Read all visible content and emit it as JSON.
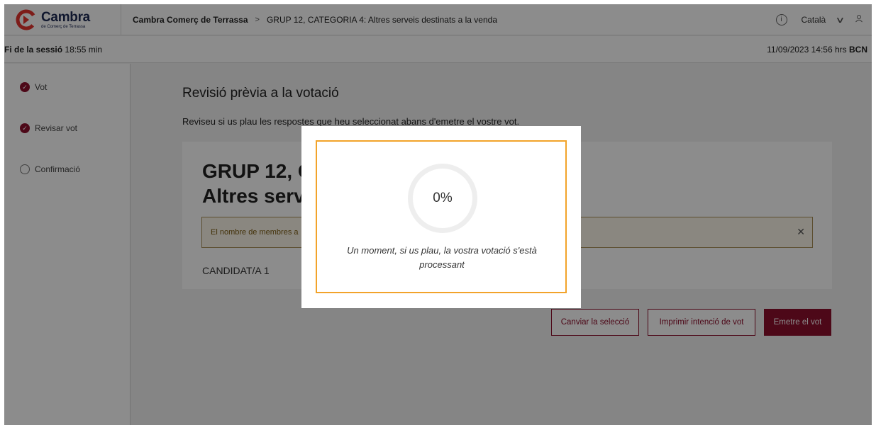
{
  "header": {
    "brand_title": "Cambra",
    "brand_subtitle": "de Comerç de Terrassa",
    "breadcrumb_1": "Cambra Comerç de Terrassa",
    "breadcrumb_sep": ">",
    "breadcrumb_2": "GRUP 12, CATEGORIA 4: Altres serveis destinats a la venda",
    "language": "Català",
    "info_icon": "i"
  },
  "session": {
    "label": "Fi de la sessió",
    "time_left": "18:55 min",
    "datetime": "11/09/2023 14:56 hrs",
    "zone": "BCN"
  },
  "sidebar": {
    "steps": [
      {
        "label": "Vot",
        "status": "done"
      },
      {
        "label": "Revisar vot",
        "status": "done"
      },
      {
        "label": "Confirmació",
        "status": "pending"
      }
    ]
  },
  "main": {
    "title": "Revisió prèvia a la votació",
    "subtitle": "Reviseu si us plau les respostes que heu seleccionat abans d'emetre el vostre vot.",
    "card_title_line1": "GRUP 12, C",
    "card_title_line2": "Altres serv",
    "alert_text": "El nombre de membres a",
    "candidate": "CANDIDAT/A 1",
    "buttons": {
      "change": "Canviar la selecció",
      "print": "Imprimir intenció de vot",
      "cast": "Emetre el vot"
    }
  },
  "modal": {
    "progress": "0%",
    "message": "Un moment, si us plau, la vostra votació s'està processant"
  },
  "colors": {
    "accent": "#8c0f2c",
    "modal_border": "#f2a32a"
  }
}
